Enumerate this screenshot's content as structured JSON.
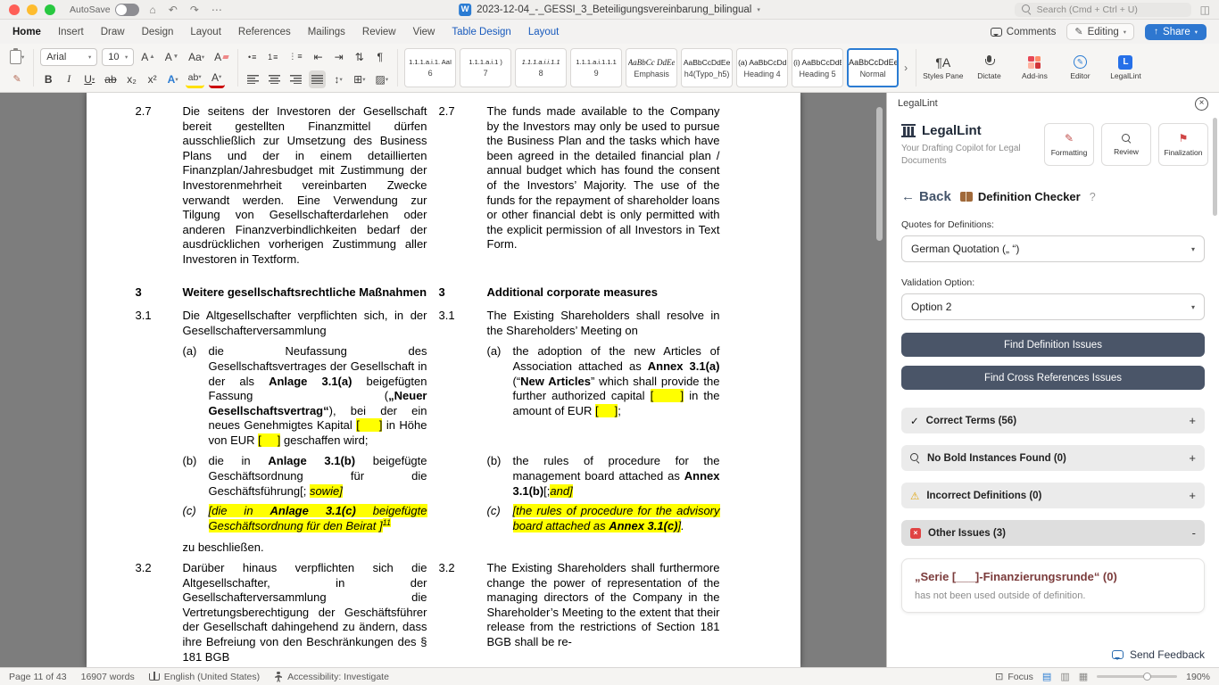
{
  "colors": {
    "contextual_tab": "#185abd",
    "accent_blue": "#2b7cd3",
    "share_button": "#2e77d0",
    "highlight": "#ffff00",
    "panel_button": "#4a5568",
    "issue_term": "#7b3b3b",
    "legallint_blue": "#2670e8",
    "canvas": "#7d7d7d"
  },
  "titlebar": {
    "autosave_label": "AutoSave",
    "doc_title": "2023-12-04_-_GESSI_3_Beteiligungsvereinbarung_bilingual",
    "search_placeholder": "Search (Cmd + Ctrl + U)"
  },
  "tabs": {
    "items": [
      {
        "label": "Home",
        "state": "active"
      },
      {
        "label": "Insert",
        "state": "normal"
      },
      {
        "label": "Draw",
        "state": "normal"
      },
      {
        "label": "Design",
        "state": "normal"
      },
      {
        "label": "Layout",
        "state": "normal"
      },
      {
        "label": "References",
        "state": "normal"
      },
      {
        "label": "Mailings",
        "state": "normal"
      },
      {
        "label": "Review",
        "state": "normal"
      },
      {
        "label": "View",
        "state": "normal"
      },
      {
        "label": "Table Design",
        "state": "contextual"
      },
      {
        "label": "Layout",
        "state": "contextual"
      }
    ],
    "comments_label": "Comments",
    "editing_label": "Editing",
    "share_label": "Share"
  },
  "ribbon": {
    "font_name": "Arial",
    "font_size": "10",
    "styles_gallery": [
      {
        "preview": "1.1.1.a.i.1. AaI",
        "name": "6"
      },
      {
        "preview": "1.1.1.a.i.1 )",
        "name": "7"
      },
      {
        "preview": "1.1.1.a.i.i.1.1",
        "name": "8"
      },
      {
        "preview": "1.1.1.a.i.1.1.1",
        "name": "9"
      },
      {
        "preview": "AaBbCc DdEe",
        "name": "Emphasis"
      },
      {
        "preview": "AaBbCcDdEe",
        "name": "h4(Typo_h5)"
      },
      {
        "preview": "(a) AaBbCcDdEe",
        "name": "Heading 4"
      },
      {
        "preview": "(i) AaBbCcDdEe",
        "name": "Heading 5"
      },
      {
        "preview": "AaBbCcDdEe",
        "name": "Normal"
      }
    ],
    "styles_pane_label": "Styles Pane",
    "dictate_label": "Dictate",
    "addins_label": "Add-ins",
    "editor_label": "Editor",
    "legallint_label": "LegalLint"
  },
  "document": {
    "rows": [
      {
        "num_de": "2.7",
        "num_en": "2.7",
        "de": [
          {
            "t": "Die seitens der Investoren der Gesellschaft bereit gestellten Finanzmittel dürfen ausschließlich zur Umsetzung des Business Plans und der in einem detaillierten Finanzplan/Jahresbudget mit Zustimmung der Investorenmehrheit vereinbarten Zwecke verwandt werden. Eine Verwendung zur Tilgung von Gesellschafterdarlehen oder anderen Finanzverbindlichkeiten bedarf der ausdrücklichen vorherigen Zustimmung aller Investoren in Textform."
          }
        ],
        "en": [
          {
            "t": "The funds made available to the Company by the Investors may only be used to pursue the Business Plan and the tasks which have been agreed in the detailed financial plan / annual budget which has found the consent of the Investors’ Majority. The use of the funds for the repayment of shareholder loans or other financial debt is only permitted with the explicit permission of all Investors in Text Form."
          }
        ]
      },
      {
        "num_de": "3",
        "num_en": "3",
        "de": [
          {
            "t": "Weitere gesellschaftsrechtliche Maßnahmen",
            "b": true
          }
        ],
        "en": [
          {
            "t": "Additional corporate measures",
            "b": true
          }
        ]
      },
      {
        "num_de": "3.1",
        "num_en": "3.1",
        "de": [
          {
            "t": "Die Altgesellschafter verpflichten sich, in der Gesellschafterversammlung"
          }
        ],
        "en": [
          {
            "t": "The Existing Shareholders shall resolve in the Shareholders’ Meeting on"
          }
        ]
      },
      {
        "marker_de": [
          {
            "t": "(a)"
          }
        ],
        "marker_en": [
          {
            "t": "(a)"
          }
        ],
        "de": [
          {
            "t": "die Neufassung des Gesellschaftsvertrages der Gesellschaft in der als "
          },
          {
            "t": "Anlage 3.1(a)",
            "b": true
          },
          {
            "t": " beigefügten Fassung ("
          },
          {
            "t": "„Neuer Gesellschaftsvertrag“",
            "b": true
          },
          {
            "t": "), bei der ein neues Genehmigtes Kapital "
          },
          {
            "t": "[     ]",
            "h": true
          },
          {
            "t": " in Höhe von EUR "
          },
          {
            "t": "[     ]",
            "h": true
          },
          {
            "t": " geschaffen wird;"
          }
        ],
        "en": [
          {
            "t": "the adoption of the new Articles of Association attached as "
          },
          {
            "t": "Annex 3.1(a)",
            "b": true
          },
          {
            "t": " (“"
          },
          {
            "t": "New Articles",
            "b": true
          },
          {
            "t": "” which shall provide the further authorized capital "
          },
          {
            "t": "[     ]",
            "h": true
          },
          {
            "t": " in the amount of EUR "
          },
          {
            "t": "[     ]",
            "h": true
          },
          {
            "t": ";"
          }
        ]
      },
      {
        "marker_de": [
          {
            "t": "(b)"
          }
        ],
        "marker_en": [
          {
            "t": "(b)"
          }
        ],
        "de": [
          {
            "t": "die in "
          },
          {
            "t": "Anlage 3.1(b)",
            "b": true
          },
          {
            "t": " beigefügte Geschäftsordnung für die Geschäftsführung[; "
          },
          {
            "t": "sowie]",
            "i": true,
            "h": true
          }
        ],
        "en": [
          {
            "t": "the rules of procedure for the management board attached as "
          },
          {
            "t": "Annex 3.1(b)",
            "b": true
          },
          {
            "t": "[;"
          },
          {
            "t": "and]",
            "i": true,
            "h": true
          }
        ]
      },
      {
        "marker_de": [
          {
            "t": "(c)",
            "i": true
          }
        ],
        "marker_en": [
          {
            "t": "(c)",
            "i": true
          }
        ],
        "de": [
          {
            "t": "[die in ",
            "i": true,
            "h": true
          },
          {
            "t": "Anlage 3.1(c)",
            "b": true,
            "i": true,
            "h": true
          },
          {
            "t": " beigefügte Geschäftsordnung für den Beirat ]",
            "i": true,
            "h": true
          },
          {
            "t": "11",
            "i": true,
            "h": true,
            "sup": true
          }
        ],
        "en": [
          {
            "t": "[the rules of procedure for the advisory board attached as ",
            "i": true,
            "h": true
          },
          {
            "t": "Annex 3.1(c)",
            "b": true,
            "i": true,
            "h": true
          },
          {
            "t": "]",
            "i": true,
            "h": true
          },
          {
            "t": ".",
            "i": true
          }
        ]
      },
      {
        "de": [
          {
            "t": "zu beschließen."
          }
        ],
        "en": []
      },
      {
        "num_de": "3.2",
        "num_en": "3.2",
        "de": [
          {
            "t": "Darüber hinaus verpflichten sich die Altgesellschafter, in der Gesellschafterversammlung die Vertretungsberechtigung der Geschäftsführer der Gesellschaft dahingehend zu ändern, dass ihre Befreiung von den Beschränkungen des § 181 BGB"
          }
        ],
        "en": [
          {
            "t": "The Existing Shareholders shall furthermore change the power of representation of the managing directors of the Company in the Shareholder’s Meeting to the extent that their release from the restrictions of Section 181 BGB shall be re-"
          }
        ]
      }
    ]
  },
  "panel": {
    "header_title": "LegalLint",
    "brand": {
      "name": "LegalLint",
      "tagline": "Your Drafting Copilot for Legal Documents"
    },
    "actions": [
      {
        "label": "Formatting"
      },
      {
        "label": "Review"
      },
      {
        "label": "Finalization"
      }
    ],
    "back_label": "Back",
    "section_title": "Definition Checker",
    "help_label": "?",
    "quotes_label": "Quotes for Definitions:",
    "quotes_value": "German Quotation („ “)",
    "validation_label": "Validation Option:",
    "validation_value": "Option 2",
    "find_definition_btn": "Find Definition Issues",
    "find_crossref_btn": "Find Cross References Issues",
    "accordions": [
      {
        "label": "Correct Terms (56)",
        "icon": "check",
        "toggle": "+"
      },
      {
        "label": "No Bold Instances Found (0)",
        "icon": "search",
        "toggle": "+"
      },
      {
        "label": "Incorrect Definitions (0)",
        "icon": "warning",
        "toggle": "+"
      },
      {
        "label": "Other Issues (3)",
        "icon": "error",
        "toggle": "-",
        "expanded": true
      }
    ],
    "issue_card": {
      "term": "„Serie [___]-Finanzierungsrunde“ (0)",
      "description": "has not been used outside of definition."
    },
    "send_feedback_label": "Send Feedback"
  },
  "statusbar": {
    "page": "Page 11 of 43",
    "words": "16907 words",
    "language": "English (United States)",
    "accessibility": "Accessibility: Investigate",
    "focus_label": "Focus",
    "zoom": "190%"
  }
}
